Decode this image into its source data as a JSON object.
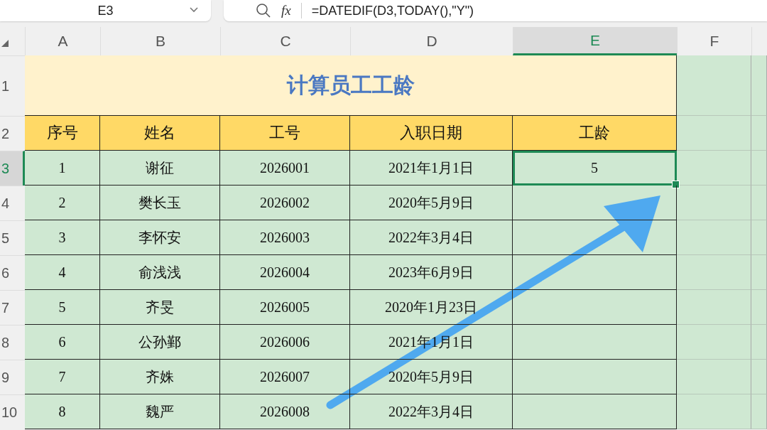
{
  "name_box": {
    "value": "E3"
  },
  "formula_bar": {
    "fx": "fx",
    "value": "=DATEDIF(D3,TODAY(),\"Y\")"
  },
  "columns": [
    {
      "label": "A",
      "selected": false
    },
    {
      "label": "B",
      "selected": false
    },
    {
      "label": "C",
      "selected": false
    },
    {
      "label": "D",
      "selected": false
    },
    {
      "label": "E",
      "selected": true
    },
    {
      "label": "F",
      "selected": false
    }
  ],
  "rows": [
    {
      "label": "1",
      "selected": false
    },
    {
      "label": "2",
      "selected": false
    },
    {
      "label": "3",
      "selected": true
    },
    {
      "label": "4",
      "selected": false
    },
    {
      "label": "5",
      "selected": false
    },
    {
      "label": "6",
      "selected": false
    },
    {
      "label": "7",
      "selected": false
    },
    {
      "label": "8",
      "selected": false
    },
    {
      "label": "9",
      "selected": false
    },
    {
      "label": "10",
      "selected": false
    }
  ],
  "sheet": {
    "title": "计算员工工龄",
    "headers": [
      "序号",
      "姓名",
      "工号",
      "入职日期",
      "工龄"
    ],
    "records": [
      {
        "cells": [
          "1",
          "谢征",
          "2026001",
          "2021年1月1日",
          "5"
        ],
        "tenure_selected": true
      },
      {
        "cells": [
          "2",
          "樊长玉",
          "2026002",
          "2020年5月9日"
        ],
        "tenure_selected": false
      },
      {
        "cells": [
          "3",
          "李怀安",
          "2026003",
          "2022年3月4日"
        ],
        "tenure_selected": false
      },
      {
        "cells": [
          "4",
          "俞浅浅",
          "2026004",
          "2023年6月9日"
        ],
        "tenure_selected": false
      },
      {
        "cells": [
          "5",
          "齐旻",
          "2026005",
          "2020年1月23日"
        ],
        "tenure_selected": false
      },
      {
        "cells": [
          "6",
          "公孙鄞",
          "2026006",
          "2021年1月1日"
        ],
        "tenure_selected": false
      },
      {
        "cells": [
          "7",
          "齐姝",
          "2026007",
          "2020年5月9日"
        ],
        "tenure_selected": false
      },
      {
        "cells": [
          "8",
          "魏严",
          "2026008",
          "2022年3月4日"
        ],
        "tenure_selected": false
      }
    ]
  }
}
